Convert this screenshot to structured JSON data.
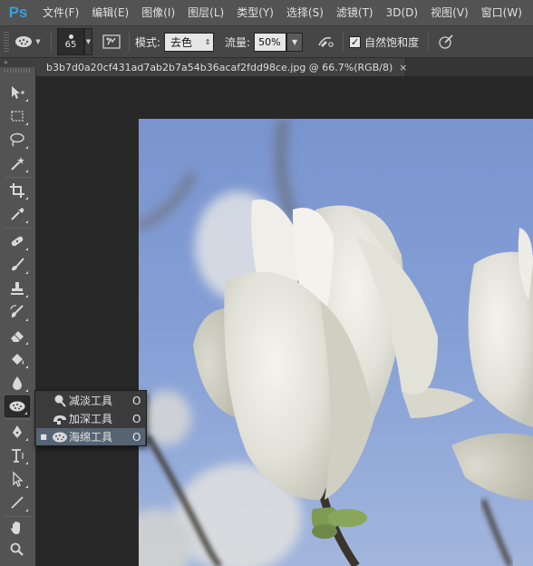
{
  "app": {
    "logo": "Ps"
  },
  "menu": [
    "文件(F)",
    "编辑(E)",
    "图像(I)",
    "图层(L)",
    "类型(Y)",
    "选择(S)",
    "滤镜(T)",
    "3D(D)",
    "视图(V)",
    "窗口(W)"
  ],
  "options": {
    "tool_preset_icon": "sponge-icon",
    "brush_size": "65",
    "mode_label": "模式:",
    "mode_value": "去色",
    "flow_label": "流量:",
    "flow_value": "50%",
    "vibrance_checked": true,
    "vibrance_check_mark": "✓",
    "vibrance_label": "自然饱和度"
  },
  "document": {
    "tab_title": "b3b7d0a20cf431ad7ab2b7a54b36acaf2fdd98ce.jpg @ 66.7%(RGB/8)",
    "close_glyph": "×"
  },
  "toolbar": {
    "head_glyph": "»",
    "tools": [
      "move-tool-icon",
      "marquee-tool-icon",
      "lasso-tool-icon",
      "magic-wand-tool-icon",
      "crop-tool-icon",
      "eyedropper-tool-icon",
      "healing-brush-tool-icon",
      "brush-tool-icon",
      "clone-stamp-tool-icon",
      "history-brush-tool-icon",
      "eraser-tool-icon",
      "paint-bucket-tool-icon",
      "blur-tool-icon",
      "sponge-tool-icon",
      "pen-tool-icon",
      "type-tool-icon",
      "path-selection-tool-icon",
      "line-tool-icon",
      "hand-tool-icon",
      "zoom-tool-icon"
    ],
    "active_tool": "sponge-tool-icon"
  },
  "flyout": {
    "items": [
      {
        "label": "减淡工具",
        "shortcut": "O",
        "icon": "dodge-tool-icon",
        "selected": false,
        "bullet": ""
      },
      {
        "label": "加深工具",
        "shortcut": "O",
        "icon": "burn-tool-icon",
        "selected": false,
        "bullet": ""
      },
      {
        "label": "海绵工具",
        "shortcut": "O",
        "icon": "sponge-tool-icon",
        "selected": true,
        "bullet": "■"
      }
    ]
  },
  "colors": {
    "sky": "#7b96cf",
    "menu_bg": "#535353",
    "flyout_selected": "#556372",
    "ps_logo": "#3e9bdc"
  }
}
